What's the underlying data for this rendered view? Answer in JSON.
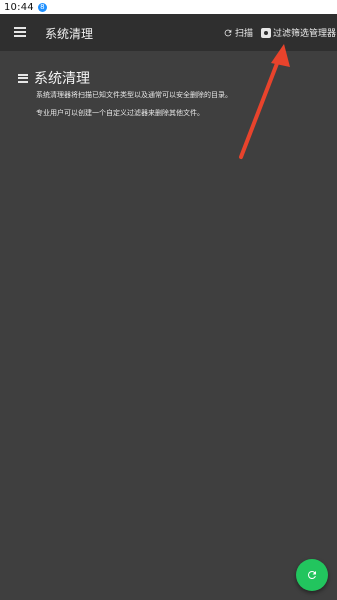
{
  "status_bar": {
    "time": "10:44",
    "badge": "8"
  },
  "app_bar": {
    "title": "系统清理",
    "menu_icon": "menu-icon",
    "actions": [
      {
        "label": "扫描",
        "icon": "refresh-icon"
      },
      {
        "label": "过滤筛选管理器",
        "icon": "filter-settings-icon"
      }
    ]
  },
  "content": {
    "section_icon": "list-icon",
    "title": "系统清理",
    "description_1": "系统清理器将扫描已知文件类型以及通常可以安全删除的目录。",
    "description_2": "专业用户可以创建一个自定义过滤器来删除其他文件。"
  },
  "fab": {
    "icon": "refresh-icon"
  },
  "colors": {
    "background": "#3f3f3f",
    "appbar": "#2f2f2f",
    "fab": "#22c55e",
    "annotation_arrow": "#e8432c"
  }
}
